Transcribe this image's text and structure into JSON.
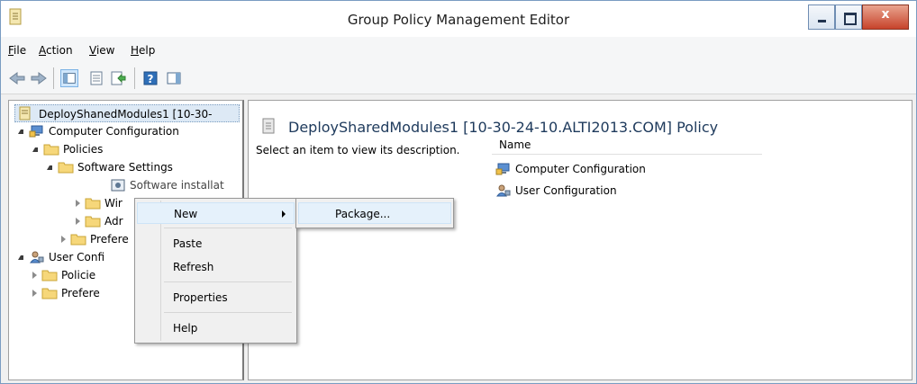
{
  "window": {
    "title": "Group Policy Management Editor"
  },
  "menu": [
    "File",
    "Action",
    "View",
    "Help"
  ],
  "toolbar": [
    "back-icon",
    "forward-icon",
    "show-hide-tree-icon",
    "properties-icon",
    "export-list-icon",
    "help-icon",
    "show-hide-action-pane-icon"
  ],
  "tree": {
    "root": "DeployShanedModules1 [10-30-",
    "computer_configuration": "Computer Configuration",
    "policies": "Policies",
    "software_settings": "Software Settings",
    "software_installation": "Software installat",
    "windows_settings": "Wir",
    "administrative_templates": "Adr",
    "preferences": "Prefere",
    "user_configuration": "User Confi",
    "user_policies": "Policie",
    "user_preferences": "Prefere"
  },
  "right_pane": {
    "title": "DeploySharedModules1 [10-30-24-10.ALTI2013.COM] Policy",
    "description": "Select an item to view its description.",
    "column_name": "Name",
    "items": [
      "Computer Configuration",
      "User Configuration"
    ]
  },
  "context_menu": {
    "new": "New",
    "paste": "Paste",
    "refresh": "Refresh",
    "properties": "Properties",
    "help": "Help"
  },
  "submenu": {
    "package": "Package..."
  }
}
